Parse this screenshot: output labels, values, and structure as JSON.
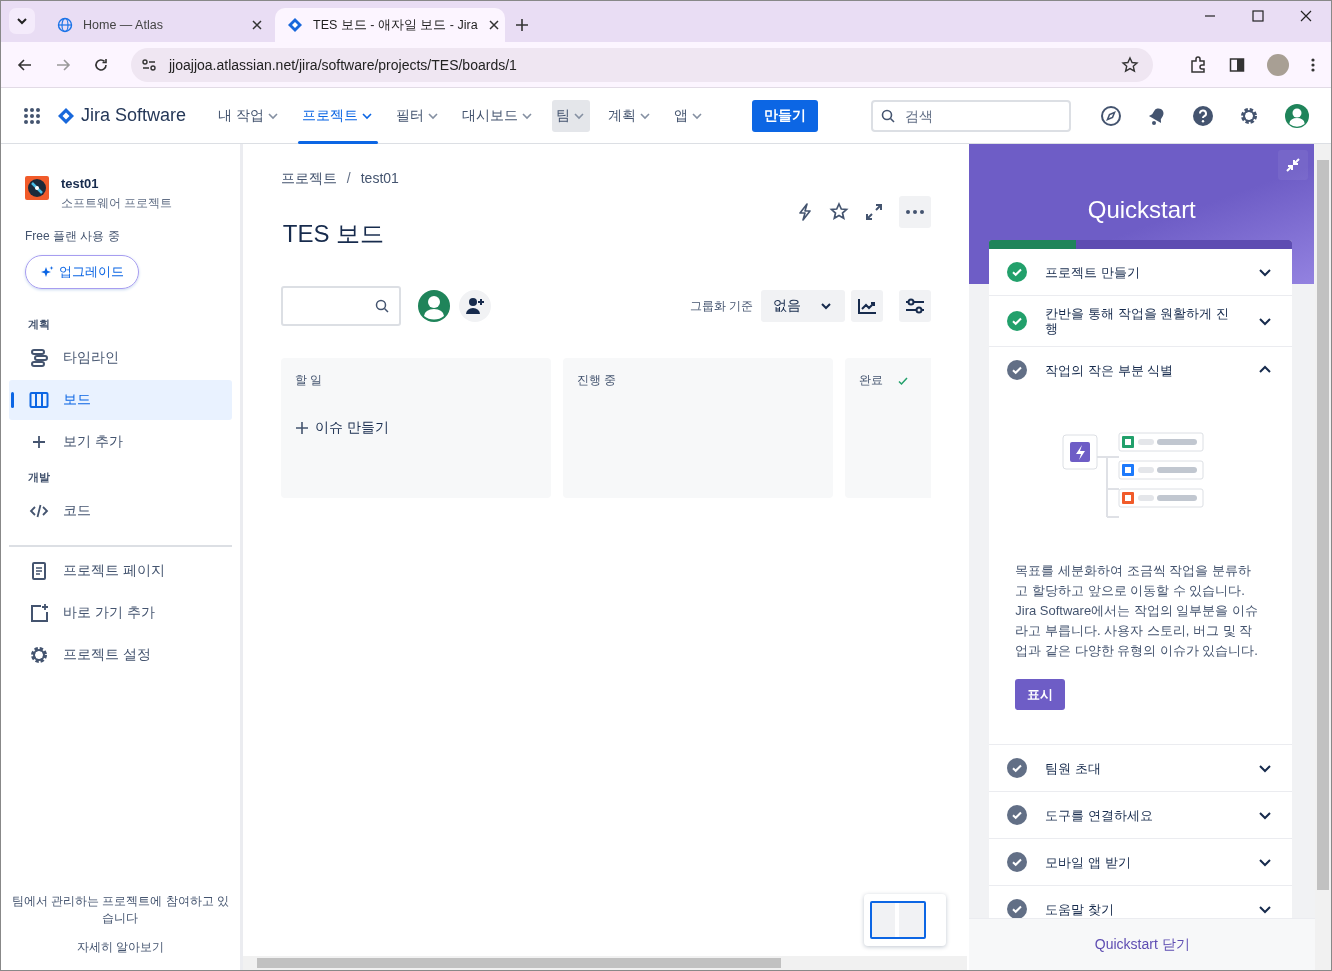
{
  "browser": {
    "tabs": [
      {
        "title": "Home — Atlas",
        "selected": false
      },
      {
        "title": "TES 보드 - 애자일 보드 - Jira",
        "selected": true
      }
    ],
    "url": "jjoajjoa.atlassian.net/jira/software/projects/TES/boards/1"
  },
  "topnav": {
    "product": "Jira Software",
    "items": [
      {
        "label": "내 작업",
        "selected": false,
        "hovered": false
      },
      {
        "label": "프로젝트",
        "selected": true,
        "hovered": false
      },
      {
        "label": "필터",
        "selected": false,
        "hovered": false
      },
      {
        "label": "대시보드",
        "selected": false,
        "hovered": false
      },
      {
        "label": "팀",
        "selected": false,
        "hovered": true
      },
      {
        "label": "계획",
        "selected": false,
        "hovered": false
      },
      {
        "label": "앱",
        "selected": false,
        "hovered": false
      }
    ],
    "create": "만들기",
    "search": {
      "placeholder": "검색"
    }
  },
  "sidebar": {
    "project": {
      "name": "test01",
      "type": "소프트웨어 프로젝트"
    },
    "plan": "Free 플랜 사용 중",
    "upgrade": "업그레이드",
    "sections": [
      {
        "heading": "계획",
        "items": [
          {
            "label": "타임라인",
            "selected": false
          },
          {
            "label": "보드",
            "selected": true
          },
          {
            "label": "보기 추가",
            "selected": false
          }
        ]
      },
      {
        "heading": "개발",
        "items": [
          {
            "label": "코드",
            "selected": false
          }
        ]
      }
    ],
    "links": [
      {
        "label": "프로젝트 페이지"
      },
      {
        "label": "바로 가기 추가"
      },
      {
        "label": "프로젝트 설정"
      }
    ],
    "footer": {
      "text": "팀에서 관리하는 프로젝트에 참여하고 있습니다",
      "link": "자세히 알아보기"
    }
  },
  "board": {
    "breadcrumbs": [
      "프로젝트",
      "test01"
    ],
    "breadcrumb_separator": "/",
    "title": "TES 보드",
    "group_by": {
      "label": "그룹화 기준",
      "value": "없음"
    },
    "columns": [
      {
        "title": "할 일",
        "done": false,
        "create": "이슈 만들기"
      },
      {
        "title": "진행 중",
        "done": false
      },
      {
        "title": "완료",
        "done": true
      }
    ]
  },
  "quickstart": {
    "title": "Quickstart",
    "level": 0.286,
    "steps": [
      {
        "label": "프로젝트 만들기",
        "done": true,
        "expanded": false
      },
      {
        "label": "칸반을 통해 작업을 원활하게 진행",
        "done": true,
        "expanded": false
      },
      {
        "label": "작업의 작은 부분 식별",
        "done": false,
        "expanded": true,
        "description": "목표를 세분화하여 조금씩 작업을 분류하고 할당하고 앞으로 이동할 수 있습니다. Jira Software에서는 작업의 일부분을 이슈라고 부릅니다. 사용자 스토리, 버그 및 작업과 같은 다양한 유형의 이슈가 있습니다.",
        "action": "표시"
      },
      {
        "label": "팀원 초대",
        "done": false,
        "expanded": false
      },
      {
        "label": "도구를 연결하세요",
        "done": false,
        "expanded": false
      },
      {
        "label": "모바일 앱 받기",
        "done": false,
        "expanded": false
      },
      {
        "label": "도움말 찾기",
        "done": false,
        "expanded": false
      }
    ],
    "close": "Quickstart 닫기"
  }
}
